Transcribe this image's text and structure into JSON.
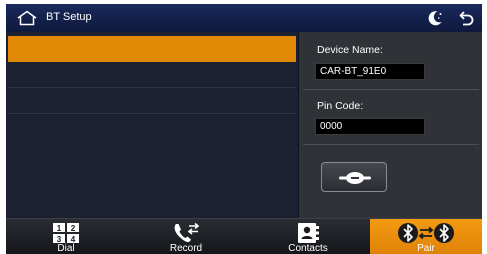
{
  "header": {
    "title": "BT Setup",
    "home_icon": "home-icon",
    "night_mode_icon": "moon-icon",
    "back_icon": "back-icon"
  },
  "device_list": {
    "selected_index": 0,
    "rows": [
      "",
      "",
      ""
    ]
  },
  "device_panel": {
    "device_name_label": "Device Name:",
    "device_name_value": "CAR-BT_91E0",
    "pin_code_label": "Pin Code:",
    "pin_code_value": "0000",
    "connect_icon": "link-icon"
  },
  "bottom_nav": {
    "tabs": [
      {
        "label": "Dial",
        "icon": "dialpad-icon"
      },
      {
        "label": "Record",
        "icon": "call-record-icon"
      },
      {
        "label": "Contacts",
        "icon": "contacts-icon"
      },
      {
        "label": "Pair",
        "icon": "bluetooth-pair-icon",
        "active": true
      }
    ]
  },
  "colors": {
    "accent": "#e28908",
    "title_bar": "#15224e",
    "list_bg": "#1b2131",
    "panel_bg": "#2f3236"
  }
}
